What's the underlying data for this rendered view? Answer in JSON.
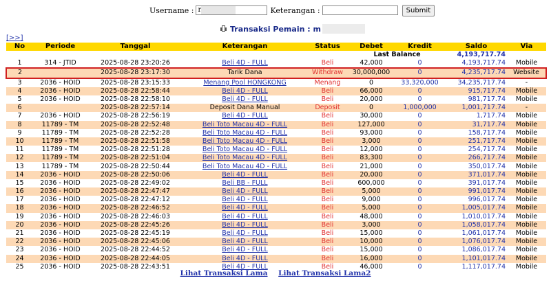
{
  "search": {
    "username_label": "Username :",
    "username_value": "r",
    "keterangan_label": "Keterangan :",
    "keterangan_value": "",
    "submit_label": "Submit"
  },
  "title": {
    "text": "Transaksi   Pemain : m"
  },
  "expand_label": "[>>]",
  "columns": [
    "No",
    "Periode",
    "Tanggal",
    "Keterangan",
    "Status",
    "Debet",
    "Kredit",
    "Saldo",
    "Via"
  ],
  "balance": {
    "label": "Last Balance",
    "value": "4,193,717.74"
  },
  "rows": [
    {
      "no": "1",
      "periode": "314 - JTID",
      "tanggal": "2025-08-28 23:20:26",
      "ket": "Beli 4D - FULL",
      "link": true,
      "status": "Beli",
      "debet": "42,000",
      "kredit": "0",
      "saldo": "4,193,717.74",
      "via": "Mobile"
    },
    {
      "no": "2",
      "periode": "",
      "tanggal": "2025-08-28 23:17:30",
      "ket": "Tarik Dana",
      "link": false,
      "status": "Withdraw",
      "debet": "30,000,000",
      "kredit": "0",
      "saldo": "4,235,717.74",
      "via": "Website",
      "highlight": true
    },
    {
      "no": "3",
      "periode": "2036 - HOID",
      "tanggal": "2025-08-28 23:15:33",
      "ket": "Menang Pool HONGKONG",
      "link": true,
      "status": "Menang",
      "debet": "0",
      "kredit": "33,320,000",
      "saldo": "34,235,717.74",
      "via": "-"
    },
    {
      "no": "4",
      "periode": "2036 - HOID",
      "tanggal": "2025-08-28 22:58:44",
      "ket": "Beli 4D - FULL",
      "link": true,
      "status": "Beli",
      "debet": "66,000",
      "kredit": "0",
      "saldo": "915,717.74",
      "via": "Mobile"
    },
    {
      "no": "5",
      "periode": "2036 - HOID",
      "tanggal": "2025-08-28 22:58:10",
      "ket": "Beli 4D - FULL",
      "link": true,
      "status": "Beli",
      "debet": "20,000",
      "kredit": "0",
      "saldo": "981,717.74",
      "via": "Mobile"
    },
    {
      "no": "6",
      "periode": "",
      "tanggal": "2025-08-28 22:57:14",
      "ket": "Deposit Dana Manual",
      "link": false,
      "status": "Deposit",
      "debet": "0",
      "kredit": "1,000,000",
      "saldo": "1,001,717.74",
      "via": "-"
    },
    {
      "no": "7",
      "periode": "2036 - HOID",
      "tanggal": "2025-08-28 22:56:19",
      "ket": "Beli 4D - FULL",
      "link": true,
      "status": "Beli",
      "debet": "30,000",
      "kredit": "0",
      "saldo": "1,717.74",
      "via": "Mobile"
    },
    {
      "no": "8",
      "periode": "11789 - TM",
      "tanggal": "2025-08-28 22:52:48",
      "ket": "Beli Toto Macau 4D - FULL",
      "link": true,
      "status": "Beli",
      "debet": "127,000",
      "kredit": "0",
      "saldo": "31,717.74",
      "via": "Mobile"
    },
    {
      "no": "9",
      "periode": "11789 - TM",
      "tanggal": "2025-08-28 22:52:28",
      "ket": "Beli Toto Macau 4D - FULL",
      "link": true,
      "status": "Beli",
      "debet": "93,000",
      "kredit": "0",
      "saldo": "158,717.74",
      "via": "Mobile"
    },
    {
      "no": "10",
      "periode": "11789 - TM",
      "tanggal": "2025-08-28 22:51:58",
      "ket": "Beli Toto Macau 4D - FULL",
      "link": true,
      "status": "Beli",
      "debet": "3,000",
      "kredit": "0",
      "saldo": "251,717.74",
      "via": "Mobile"
    },
    {
      "no": "11",
      "periode": "11789 - TM",
      "tanggal": "2025-08-28 22:51:28",
      "ket": "Beli Toto Macau 4D - FULL",
      "link": true,
      "status": "Beli",
      "debet": "12,000",
      "kredit": "0",
      "saldo": "254,717.74",
      "via": "Mobile"
    },
    {
      "no": "12",
      "periode": "11789 - TM",
      "tanggal": "2025-08-28 22:51:04",
      "ket": "Beli Toto Macau 4D - FULL",
      "link": true,
      "status": "Beli",
      "debet": "83,300",
      "kredit": "0",
      "saldo": "266,717.74",
      "via": "Mobile"
    },
    {
      "no": "13",
      "periode": "11789 - TM",
      "tanggal": "2025-08-28 22:50:44",
      "ket": "Beli Toto Macau 4D - FULL",
      "link": true,
      "status": "Beli",
      "debet": "21,000",
      "kredit": "0",
      "saldo": "350,017.74",
      "via": "Mobile"
    },
    {
      "no": "14",
      "periode": "2036 - HOID",
      "tanggal": "2025-08-28 22:50:06",
      "ket": "Beli 4D - FULL",
      "link": true,
      "status": "Beli",
      "debet": "20,000",
      "kredit": "0",
      "saldo": "371,017.74",
      "via": "Mobile"
    },
    {
      "no": "15",
      "periode": "2036 - HOID",
      "tanggal": "2025-08-28 22:49:02",
      "ket": "Beli BB - FULL",
      "link": true,
      "status": "Beli",
      "debet": "600,000",
      "kredit": "0",
      "saldo": "391,017.74",
      "via": "Mobile"
    },
    {
      "no": "16",
      "periode": "2036 - HOID",
      "tanggal": "2025-08-28 22:47:47",
      "ket": "Beli 4D - FULL",
      "link": true,
      "status": "Beli",
      "debet": "5,000",
      "kredit": "0",
      "saldo": "991,017.74",
      "via": "Mobile"
    },
    {
      "no": "17",
      "periode": "2036 - HOID",
      "tanggal": "2025-08-28 22:47:12",
      "ket": "Beli 4D - FULL",
      "link": true,
      "status": "Beli",
      "debet": "9,000",
      "kredit": "0",
      "saldo": "996,017.74",
      "via": "Mobile"
    },
    {
      "no": "18",
      "periode": "2036 - HOID",
      "tanggal": "2025-08-28 22:46:52",
      "ket": "Beli 4D - FULL",
      "link": true,
      "status": "Beli",
      "debet": "5,000",
      "kredit": "0",
      "saldo": "1,005,017.74",
      "via": "Mobile"
    },
    {
      "no": "19",
      "periode": "2036 - HOID",
      "tanggal": "2025-08-28 22:46:03",
      "ket": "Beli 4D - FULL",
      "link": true,
      "status": "Beli",
      "debet": "48,000",
      "kredit": "0",
      "saldo": "1,010,017.74",
      "via": "Mobile"
    },
    {
      "no": "20",
      "periode": "2036 - HOID",
      "tanggal": "2025-08-28 22:45:26",
      "ket": "Beli 4D - FULL",
      "link": true,
      "status": "Beli",
      "debet": "3,000",
      "kredit": "0",
      "saldo": "1,058,017.74",
      "via": "Mobile"
    },
    {
      "no": "21",
      "periode": "2036 - HOID",
      "tanggal": "2025-08-28 22:45:19",
      "ket": "Beli 4D - FULL",
      "link": true,
      "status": "Beli",
      "debet": "15,000",
      "kredit": "0",
      "saldo": "1,061,017.74",
      "via": "Mobile"
    },
    {
      "no": "22",
      "periode": "2036 - HOID",
      "tanggal": "2025-08-28 22:45:06",
      "ket": "Beli 4D - FULL",
      "link": true,
      "status": "Beli",
      "debet": "10,000",
      "kredit": "0",
      "saldo": "1,076,017.74",
      "via": "Mobile"
    },
    {
      "no": "23",
      "periode": "2036 - HOID",
      "tanggal": "2025-08-28 22:44:52",
      "ket": "Beli 4D - FULL",
      "link": true,
      "status": "Beli",
      "debet": "15,000",
      "kredit": "0",
      "saldo": "1,086,017.74",
      "via": "Mobile"
    },
    {
      "no": "24",
      "periode": "2036 - HOID",
      "tanggal": "2025-08-28 22:44:05",
      "ket": "Beli 4D - FULL",
      "link": true,
      "status": "Beli",
      "debet": "16,000",
      "kredit": "0",
      "saldo": "1,101,017.74",
      "via": "Mobile"
    },
    {
      "no": "25",
      "periode": "2036 - HOID",
      "tanggal": "2025-08-28 22:43:51",
      "ket": "Beli 4D - FULL",
      "link": true,
      "status": "Beli",
      "debet": "46,000",
      "kredit": "0",
      "saldo": "1,117,017.74",
      "via": "Mobile"
    }
  ],
  "footer": {
    "link1": "Lihat Transaksi Lama",
    "link2": "Lihat Transaksi Lama2"
  },
  "colors": {
    "header_bg": "#ffd800",
    "row_alt": "#fdd9b5",
    "link": "#2233aa",
    "status_red": "#e03030",
    "highlight_border": "#d02020"
  }
}
